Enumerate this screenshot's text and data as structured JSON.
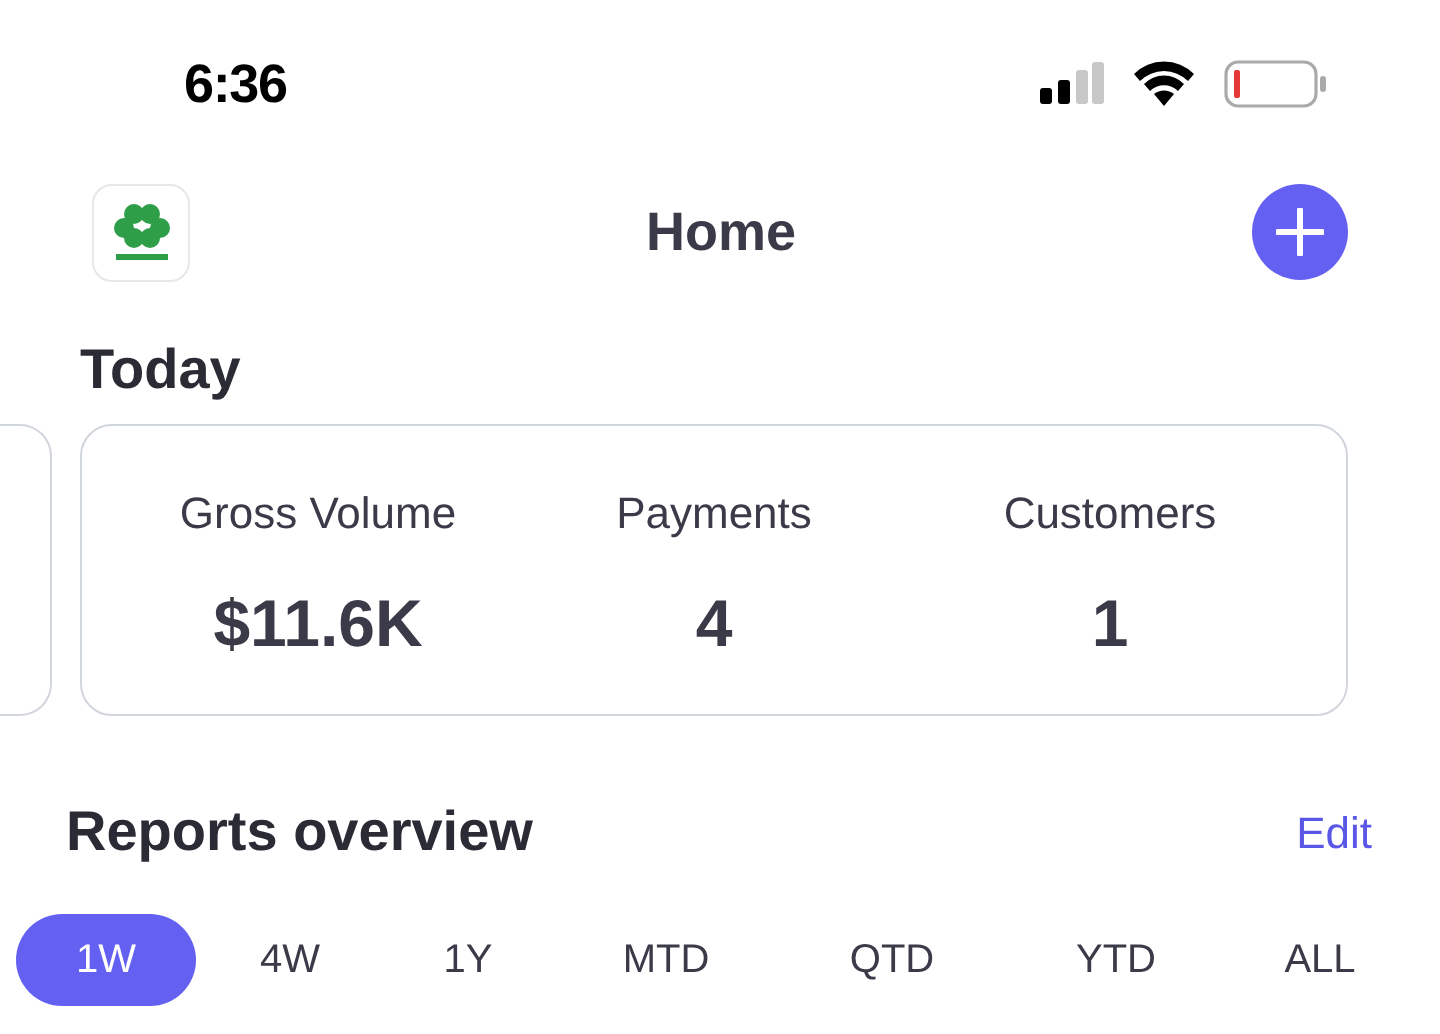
{
  "status_bar": {
    "time": "6:36"
  },
  "header": {
    "title": "Home"
  },
  "today": {
    "title": "Today",
    "stats": [
      {
        "label": "Gross Volume",
        "value": "$11.6K"
      },
      {
        "label": "Payments",
        "value": "4"
      },
      {
        "label": "Customers",
        "value": "1"
      }
    ]
  },
  "reports": {
    "title": "Reports overview",
    "edit": "Edit",
    "tabs": [
      {
        "label": "1W",
        "selected": true
      },
      {
        "label": "4W",
        "selected": false
      },
      {
        "label": "1Y",
        "selected": false
      },
      {
        "label": "MTD",
        "selected": false
      },
      {
        "label": "QTD",
        "selected": false
      },
      {
        "label": "YTD",
        "selected": false
      },
      {
        "label": "ALL",
        "selected": false
      }
    ]
  }
}
